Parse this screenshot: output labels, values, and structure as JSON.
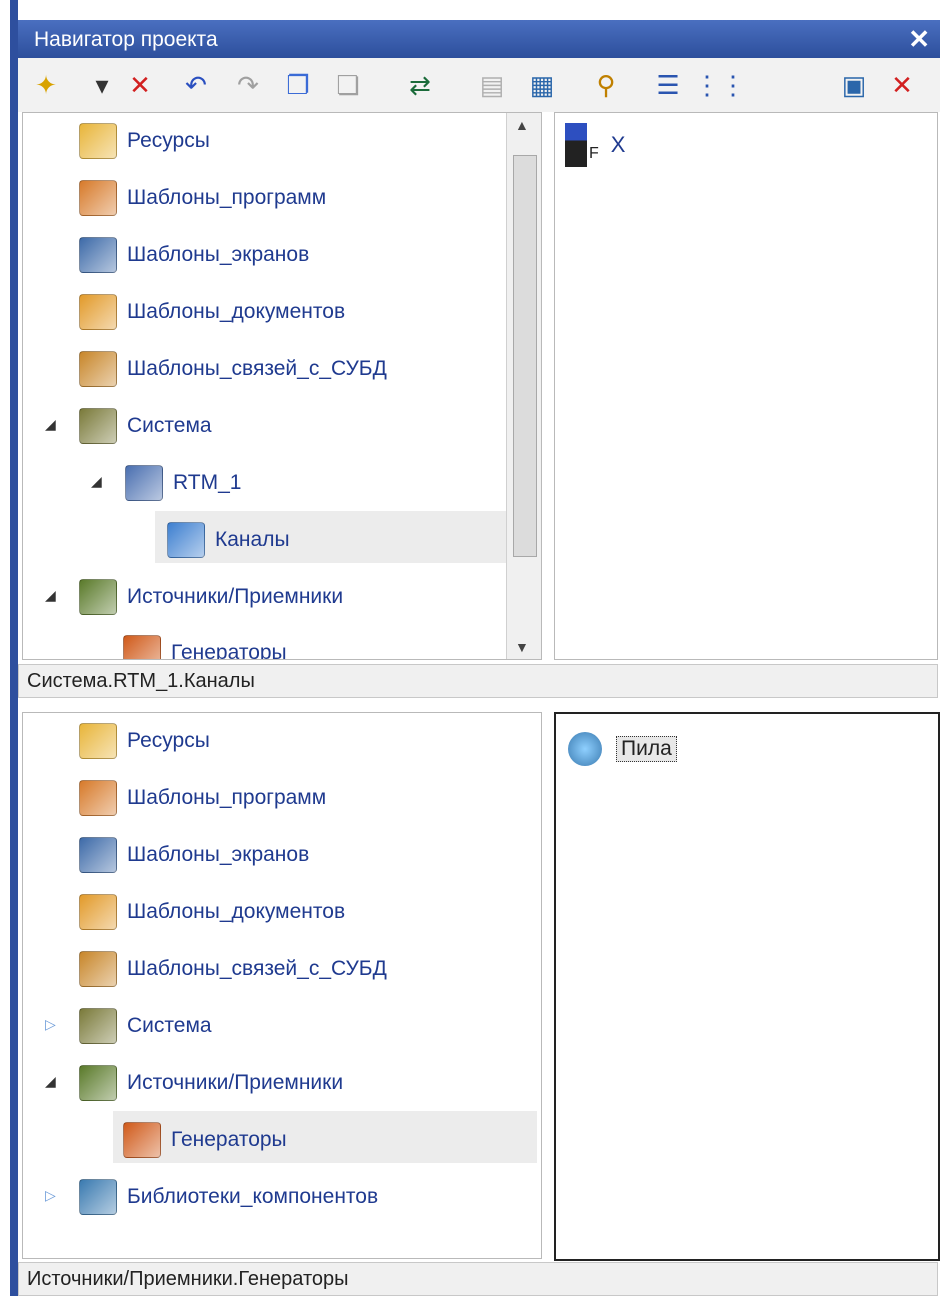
{
  "window": {
    "title": "Навигатор проекта",
    "close_glyph": "✕"
  },
  "toolbar": {
    "buttons": [
      {
        "name": "new-item-icon",
        "glyph": "✦",
        "color": "#d8a200"
      },
      {
        "name": "dropdown-arrow-icon",
        "glyph": "▾",
        "color": "#333333"
      },
      {
        "name": "delete-icon",
        "glyph": "✕",
        "color": "#d22020"
      },
      {
        "name": "undo-icon",
        "glyph": "↶",
        "color": "#2a4fc0"
      },
      {
        "name": "redo-icon",
        "glyph": "↷",
        "color": "#a0a0a0"
      },
      {
        "name": "copy-icon",
        "glyph": "❐",
        "color": "#3b6bd6"
      },
      {
        "name": "paste-icon",
        "glyph": "❏",
        "color": "#a0a0a0"
      },
      {
        "name": "link-icon",
        "glyph": "⇄",
        "color": "#1b6b3a"
      },
      {
        "name": "disabled-tool-icon",
        "glyph": "▤",
        "color": "#b0b0b0"
      },
      {
        "name": "properties-icon",
        "glyph": "▦",
        "color": "#2a66aa"
      },
      {
        "name": "binoculars-icon",
        "glyph": "⚲",
        "color": "#c08000"
      },
      {
        "name": "tree-view-icon",
        "glyph": "☰",
        "color": "#2a55b0"
      },
      {
        "name": "list-view-icon",
        "glyph": "⋮⋮",
        "color": "#2a55b0"
      },
      {
        "name": "settings-icon",
        "glyph": "▣",
        "color": "#2a66aa"
      },
      {
        "name": "close-panel-icon",
        "glyph": "✕",
        "color": "#d22020"
      }
    ]
  },
  "top_tree": {
    "items": [
      {
        "label": "Ресурсы",
        "icon": "resources-icon",
        "color": "#e8b53a",
        "expander": ""
      },
      {
        "label": "Шаблоны_программ",
        "icon": "program-templates-icon",
        "color": "#d77a2a",
        "expander": ""
      },
      {
        "label": "Шаблоны_экранов",
        "icon": "screen-templates-icon",
        "color": "#3d6aa8",
        "expander": ""
      },
      {
        "label": "Шаблоны_документов",
        "icon": "document-templates-icon",
        "color": "#e29a2a",
        "expander": ""
      },
      {
        "label": "Шаблоны_связей_с_СУБД",
        "icon": "dbms-templates-icon",
        "color": "#c8862a",
        "expander": ""
      },
      {
        "label": "Система",
        "icon": "system-icon",
        "color": "#7a7a3a",
        "expander": "◢"
      },
      {
        "label": "RTM_1",
        "icon": "rtm-icon",
        "color": "#4a6fb0",
        "expander": "◢"
      },
      {
        "label": "Каналы",
        "icon": "channels-icon",
        "color": "#3d7fd0",
        "expander": ""
      },
      {
        "label": "Источники/Приемники",
        "icon": "sources-icon",
        "color": "#5a7a2a",
        "expander": "◢"
      },
      {
        "label": "Генераторы",
        "icon": "generators-icon",
        "color": "#d05a1a",
        "expander": ""
      }
    ]
  },
  "top_right": {
    "item_label": "X",
    "item_subscript": "F"
  },
  "path_top": "Система.RTM_1.Каналы",
  "bottom_tree": {
    "items": [
      {
        "label": "Ресурсы",
        "icon": "resources-icon",
        "color": "#e8b53a",
        "expander": ""
      },
      {
        "label": "Шаблоны_программ",
        "icon": "program-templates-icon",
        "color": "#d77a2a",
        "expander": ""
      },
      {
        "label": "Шаблоны_экранов",
        "icon": "screen-templates-icon",
        "color": "#3d6aa8",
        "expander": ""
      },
      {
        "label": "Шаблоны_документов",
        "icon": "document-templates-icon",
        "color": "#e29a2a",
        "expander": ""
      },
      {
        "label": "Шаблоны_связей_с_СУБД",
        "icon": "dbms-templates-icon",
        "color": "#c8862a",
        "expander": ""
      },
      {
        "label": "Система",
        "icon": "system-icon",
        "color": "#7a7a3a",
        "expander": "▷"
      },
      {
        "label": "Источники/Приемники",
        "icon": "sources-icon",
        "color": "#5a7a2a",
        "expander": "◢"
      },
      {
        "label": "Генераторы",
        "icon": "generators-icon",
        "color": "#d05a1a",
        "expander": ""
      },
      {
        "label": "Библиотеки_компонентов",
        "icon": "component-libraries-icon",
        "color": "#3a7ab0",
        "expander": "▷"
      }
    ]
  },
  "bottom_right": {
    "item_label": "Пила"
  },
  "path_bottom": "Источники/Приемники.Генераторы"
}
